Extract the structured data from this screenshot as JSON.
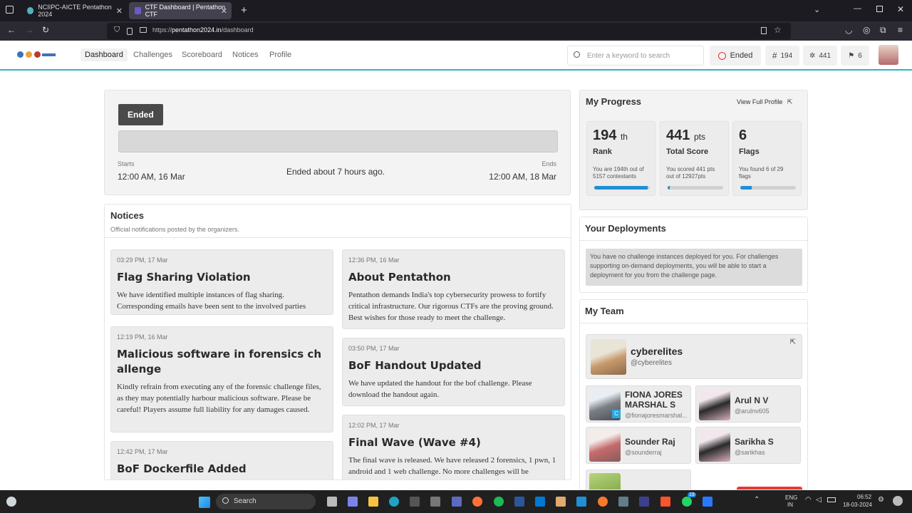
{
  "browser": {
    "tabs": [
      {
        "title": "NCIIPC-AICTE Pentathon 2024"
      },
      {
        "title": "CTF Dashboard | Pentathon CTF"
      }
    ],
    "new_tab": "+",
    "url_host": "pentathon2024.in",
    "url_path": "/dashboard",
    "url_prefix": "https://"
  },
  "header": {
    "nav": [
      "Dashboard",
      "Challenges",
      "Scoreboard",
      "Notices",
      "Profile"
    ],
    "search_placeholder": "Enter a keyword to search",
    "status": "Ended",
    "rank": "194",
    "score": "441",
    "flags": "6"
  },
  "event": {
    "status": "Ended",
    "starts_label": "Starts",
    "starts": "12:00 AM, 16 Mar",
    "ends_label": "Ends",
    "ends": "12:00 AM, 18 Mar",
    "message": "Ended about 7 hours ago."
  },
  "notices": {
    "title": "Notices",
    "subtitle": "Official notifications posted by the organizers.",
    "left": [
      {
        "time": "03:29 PM, 17 Mar",
        "title": "Flag Sharing Violation",
        "body": "We have identified multiple instances of flag sharing. Corresponding emails have been sent to the involved parties"
      },
      {
        "time": "12:19 PM, 16 Mar",
        "title": "Malicious software in forensics challenge",
        "body": "Kindly refrain from executing any of the forensic challenge files, as they may potentially harbour malicious software. Please be careful! Players assume full liability for any damages caused."
      },
      {
        "time": "12:42 PM, 17 Mar",
        "title": "BoF Dockerfile Added",
        "body": ""
      }
    ],
    "right": [
      {
        "time": "12:36 PM, 16 Mar",
        "title": "About Pentathon",
        "body": "Pentathon demands India's top cybersecurity prowess to fortify critical infrastructure. Our rigorous CTFs are the proving ground. Best wishes for those ready to meet the challenge."
      },
      {
        "time": "03:50 PM, 17 Mar",
        "title": "BoF Handout Updated",
        "body": "We have updated the handout for the bof challenge. Please download the handout again."
      },
      {
        "time": "12:02 PM, 17 Mar",
        "title": "Final Wave (Wave #4)",
        "body": "The final wave is released. We have released 2 forensics, 1 pwn, 1 android and 1 web challenge. No more challenges will be"
      }
    ]
  },
  "progress": {
    "title": "My Progress",
    "link": "View Full Profile",
    "stats": [
      {
        "num": "194",
        "suffix": "th",
        "label": "Rank",
        "detail": "You are 194th out of 5157 contestants",
        "fill": 0.96
      },
      {
        "num": "441",
        "suffix": "pts",
        "label": "Total Score",
        "detail": "You scored 441 pts out of 12927pts",
        "fill": 0.04
      },
      {
        "num": "6",
        "suffix": "",
        "label": "Flags",
        "detail": "You found 6 of 29 flags",
        "fill": 0.21
      }
    ]
  },
  "deployments": {
    "title": "Your Deployments",
    "message": "You have no challenge instances deployed for you. For challenges supporting on-demand deployments, you will be able to start a deployment for you from the challenge page."
  },
  "team": {
    "title": "My Team",
    "name": "cyberelites",
    "handle": "@cyberelites",
    "members": [
      {
        "name": "FIONA JORES MARSHAL S",
        "handle": "@fionajoresmarshal..."
      },
      {
        "name": "Arul N V",
        "handle": "@arulnv605"
      },
      {
        "name": "Sounder Raj",
        "handle": "@sounderraj"
      },
      {
        "name": "Sarikha S",
        "handle": "@sarikhas"
      }
    ]
  },
  "taskbar": {
    "search": "Search",
    "lang": "ENG",
    "region": "IN",
    "time": "06:52",
    "date": "18-03-2024",
    "badge": "19"
  },
  "colors": {
    "accent": "#29b6c4",
    "ended_badge": "#4a4a4a",
    "progress": "#1f8fd6",
    "ended_icon": "#e53935"
  }
}
